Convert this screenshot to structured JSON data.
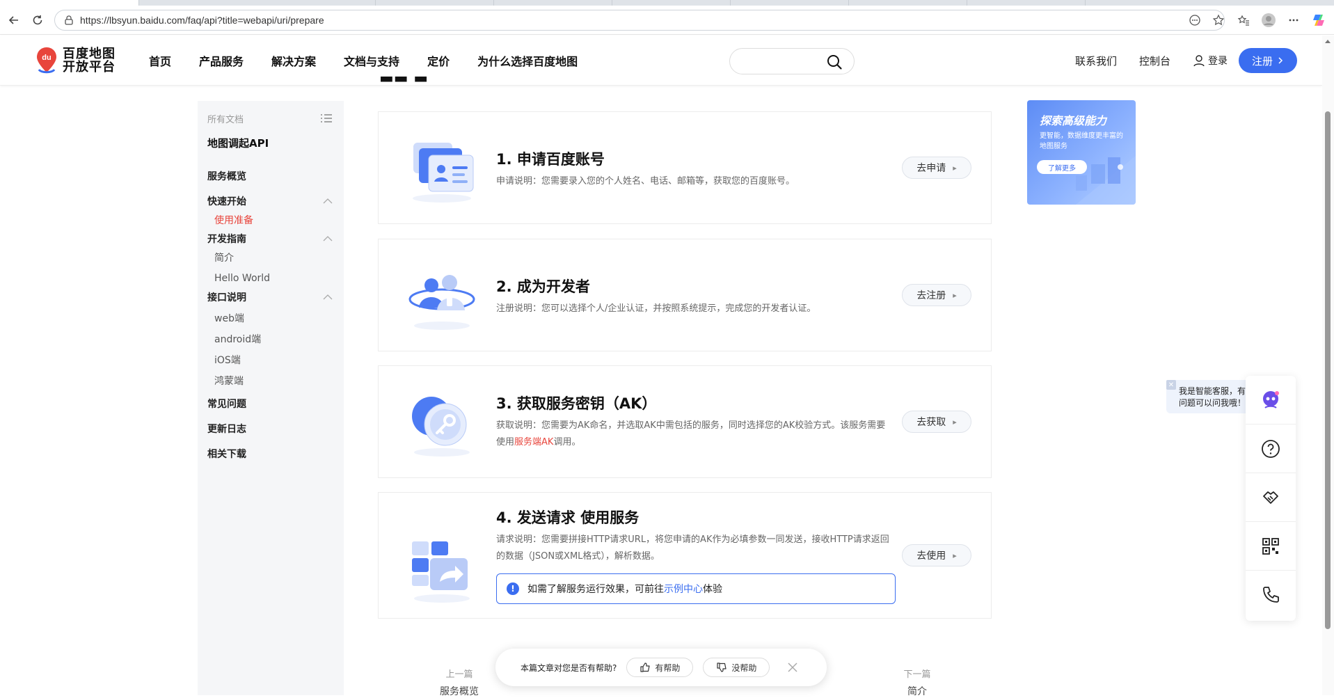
{
  "browser": {
    "url": "https://lbsyun.baidu.com/faq/api?title=webapi/uri/prepare"
  },
  "header": {
    "logo_text_line1": "百度地图",
    "logo_text_line2": "开放平台",
    "logo_badge": "du",
    "nav": [
      "首页",
      "产品服务",
      "解决方案",
      "文档与支持",
      "定价",
      "为什么选择百度地图"
    ],
    "contact": "联系我们",
    "console": "控制台",
    "login": "登录",
    "register": "注册"
  },
  "sidebar": {
    "all_docs": "所有文档",
    "title": "地图调起API",
    "items": [
      {
        "label": "服务概览",
        "level": 1
      },
      {
        "label": "快速开始",
        "level": 1,
        "expanded": true
      },
      {
        "label": "使用准备",
        "level": 2,
        "active": true
      },
      {
        "label": "开发指南",
        "level": 1,
        "expanded": true
      },
      {
        "label": "简介",
        "level": 2
      },
      {
        "label": "Hello World",
        "level": 2
      },
      {
        "label": "接口说明",
        "level": 1,
        "expanded": true
      },
      {
        "label": "web端",
        "level": 2
      },
      {
        "label": "android端",
        "level": 2
      },
      {
        "label": "iOS端",
        "level": 2
      },
      {
        "label": "鸿蒙端",
        "level": 2
      },
      {
        "label": "常见问题",
        "level": 1
      },
      {
        "label": "更新日志",
        "level": 1
      },
      {
        "label": "相关下载",
        "level": 1
      }
    ]
  },
  "steps": [
    {
      "title": "1. 申请百度账号",
      "desc": "申请说明：您需要录入您的个人姓名、电话、邮箱等，获取您的百度账号。",
      "action": "去申请"
    },
    {
      "title": "2. 成为开发者",
      "desc": "注册说明：您可以选择个人/企业认证，并按照系统提示，完成您的开发者认证。",
      "action": "去注册"
    },
    {
      "title": "3. 获取服务密钥（AK）",
      "desc_pre": "获取说明：您需要为AK命名，并选取AK中需包括的服务，同时选择您的AK校验方式。该服务需要使用",
      "desc_link": "服务端AK",
      "desc_post": "调用。",
      "action": "去获取"
    },
    {
      "title": "4. 发送请求 使用服务",
      "desc": "请求说明：您需要拼接HTTP请求URL，将您申请的AK作为必填参数一同发送，接收HTTP请求返回的数据（JSON或XML格式），解析数据。",
      "action": "去使用"
    }
  ],
  "notice": {
    "pre": "如需了解服务运行效果，可前往",
    "link": "示例中心",
    "post": "体验"
  },
  "promo": {
    "title": "探索高级能力",
    "subtitle": "更智能，数据维度更丰富的地图服务",
    "button": "了解更多"
  },
  "bot": {
    "bubble": "我是智能客服，有问题可以问我哦！"
  },
  "pager": {
    "prev_label": "上一篇",
    "prev_title": "服务概览",
    "next_label": "下一篇",
    "next_title": "简介"
  },
  "feedback": {
    "question": "本篇文章对您是否有帮助?",
    "yes": "有帮助",
    "no": "没帮助"
  },
  "colors": {
    "accent": "#3a6df0",
    "active_red": "#e8453c"
  }
}
